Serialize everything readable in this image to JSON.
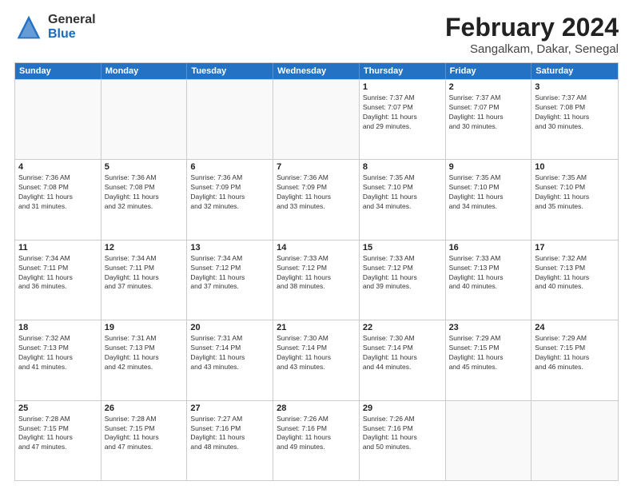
{
  "logo": {
    "general": "General",
    "blue": "Blue"
  },
  "title": "February 2024",
  "subtitle": "Sangalkam, Dakar, Senegal",
  "calendar": {
    "headers": [
      "Sunday",
      "Monday",
      "Tuesday",
      "Wednesday",
      "Thursday",
      "Friday",
      "Saturday"
    ],
    "weeks": [
      [
        {
          "day": "",
          "info": ""
        },
        {
          "day": "",
          "info": ""
        },
        {
          "day": "",
          "info": ""
        },
        {
          "day": "",
          "info": ""
        },
        {
          "day": "1",
          "info": "Sunrise: 7:37 AM\nSunset: 7:07 PM\nDaylight: 11 hours\nand 29 minutes."
        },
        {
          "day": "2",
          "info": "Sunrise: 7:37 AM\nSunset: 7:07 PM\nDaylight: 11 hours\nand 30 minutes."
        },
        {
          "day": "3",
          "info": "Sunrise: 7:37 AM\nSunset: 7:08 PM\nDaylight: 11 hours\nand 30 minutes."
        }
      ],
      [
        {
          "day": "4",
          "info": "Sunrise: 7:36 AM\nSunset: 7:08 PM\nDaylight: 11 hours\nand 31 minutes."
        },
        {
          "day": "5",
          "info": "Sunrise: 7:36 AM\nSunset: 7:08 PM\nDaylight: 11 hours\nand 32 minutes."
        },
        {
          "day": "6",
          "info": "Sunrise: 7:36 AM\nSunset: 7:09 PM\nDaylight: 11 hours\nand 32 minutes."
        },
        {
          "day": "7",
          "info": "Sunrise: 7:36 AM\nSunset: 7:09 PM\nDaylight: 11 hours\nand 33 minutes."
        },
        {
          "day": "8",
          "info": "Sunrise: 7:35 AM\nSunset: 7:10 PM\nDaylight: 11 hours\nand 34 minutes."
        },
        {
          "day": "9",
          "info": "Sunrise: 7:35 AM\nSunset: 7:10 PM\nDaylight: 11 hours\nand 34 minutes."
        },
        {
          "day": "10",
          "info": "Sunrise: 7:35 AM\nSunset: 7:10 PM\nDaylight: 11 hours\nand 35 minutes."
        }
      ],
      [
        {
          "day": "11",
          "info": "Sunrise: 7:34 AM\nSunset: 7:11 PM\nDaylight: 11 hours\nand 36 minutes."
        },
        {
          "day": "12",
          "info": "Sunrise: 7:34 AM\nSunset: 7:11 PM\nDaylight: 11 hours\nand 37 minutes."
        },
        {
          "day": "13",
          "info": "Sunrise: 7:34 AM\nSunset: 7:12 PM\nDaylight: 11 hours\nand 37 minutes."
        },
        {
          "day": "14",
          "info": "Sunrise: 7:33 AM\nSunset: 7:12 PM\nDaylight: 11 hours\nand 38 minutes."
        },
        {
          "day": "15",
          "info": "Sunrise: 7:33 AM\nSunset: 7:12 PM\nDaylight: 11 hours\nand 39 minutes."
        },
        {
          "day": "16",
          "info": "Sunrise: 7:33 AM\nSunset: 7:13 PM\nDaylight: 11 hours\nand 40 minutes."
        },
        {
          "day": "17",
          "info": "Sunrise: 7:32 AM\nSunset: 7:13 PM\nDaylight: 11 hours\nand 40 minutes."
        }
      ],
      [
        {
          "day": "18",
          "info": "Sunrise: 7:32 AM\nSunset: 7:13 PM\nDaylight: 11 hours\nand 41 minutes."
        },
        {
          "day": "19",
          "info": "Sunrise: 7:31 AM\nSunset: 7:13 PM\nDaylight: 11 hours\nand 42 minutes."
        },
        {
          "day": "20",
          "info": "Sunrise: 7:31 AM\nSunset: 7:14 PM\nDaylight: 11 hours\nand 43 minutes."
        },
        {
          "day": "21",
          "info": "Sunrise: 7:30 AM\nSunset: 7:14 PM\nDaylight: 11 hours\nand 43 minutes."
        },
        {
          "day": "22",
          "info": "Sunrise: 7:30 AM\nSunset: 7:14 PM\nDaylight: 11 hours\nand 44 minutes."
        },
        {
          "day": "23",
          "info": "Sunrise: 7:29 AM\nSunset: 7:15 PM\nDaylight: 11 hours\nand 45 minutes."
        },
        {
          "day": "24",
          "info": "Sunrise: 7:29 AM\nSunset: 7:15 PM\nDaylight: 11 hours\nand 46 minutes."
        }
      ],
      [
        {
          "day": "25",
          "info": "Sunrise: 7:28 AM\nSunset: 7:15 PM\nDaylight: 11 hours\nand 47 minutes."
        },
        {
          "day": "26",
          "info": "Sunrise: 7:28 AM\nSunset: 7:15 PM\nDaylight: 11 hours\nand 47 minutes."
        },
        {
          "day": "27",
          "info": "Sunrise: 7:27 AM\nSunset: 7:16 PM\nDaylight: 11 hours\nand 48 minutes."
        },
        {
          "day": "28",
          "info": "Sunrise: 7:26 AM\nSunset: 7:16 PM\nDaylight: 11 hours\nand 49 minutes."
        },
        {
          "day": "29",
          "info": "Sunrise: 7:26 AM\nSunset: 7:16 PM\nDaylight: 11 hours\nand 50 minutes."
        },
        {
          "day": "",
          "info": ""
        },
        {
          "day": "",
          "info": ""
        }
      ]
    ]
  }
}
